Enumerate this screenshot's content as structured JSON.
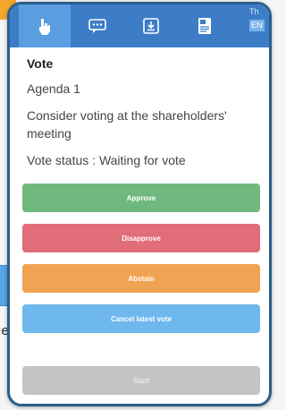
{
  "background": {
    "partial_text": "e."
  },
  "tabbar": {
    "tabs": [
      {
        "icon": "vote-hand-icon",
        "active": true
      },
      {
        "icon": "chat-icon",
        "active": false
      },
      {
        "icon": "download-icon",
        "active": false
      },
      {
        "icon": "document-icon",
        "active": false
      }
    ],
    "extra_label": "Th",
    "lang_label": "EN"
  },
  "vote": {
    "title": "Vote",
    "agenda": "Agenda 1",
    "description": "Consider voting at the shareholders' meeting",
    "status": "Vote status : Waiting for vote"
  },
  "buttons": {
    "approve": "Approve",
    "disapprove": "Disapprove",
    "abstain": "Abstain",
    "cancel": "Cancel latest vote",
    "start": "Start"
  },
  "colors": {
    "tabbar": "#3d7dc8",
    "approve": "#6fb97f",
    "disapprove": "#e06d77",
    "abstain": "#f1a354",
    "cancel": "#6fb8ee",
    "start": "#c4c4c4"
  }
}
